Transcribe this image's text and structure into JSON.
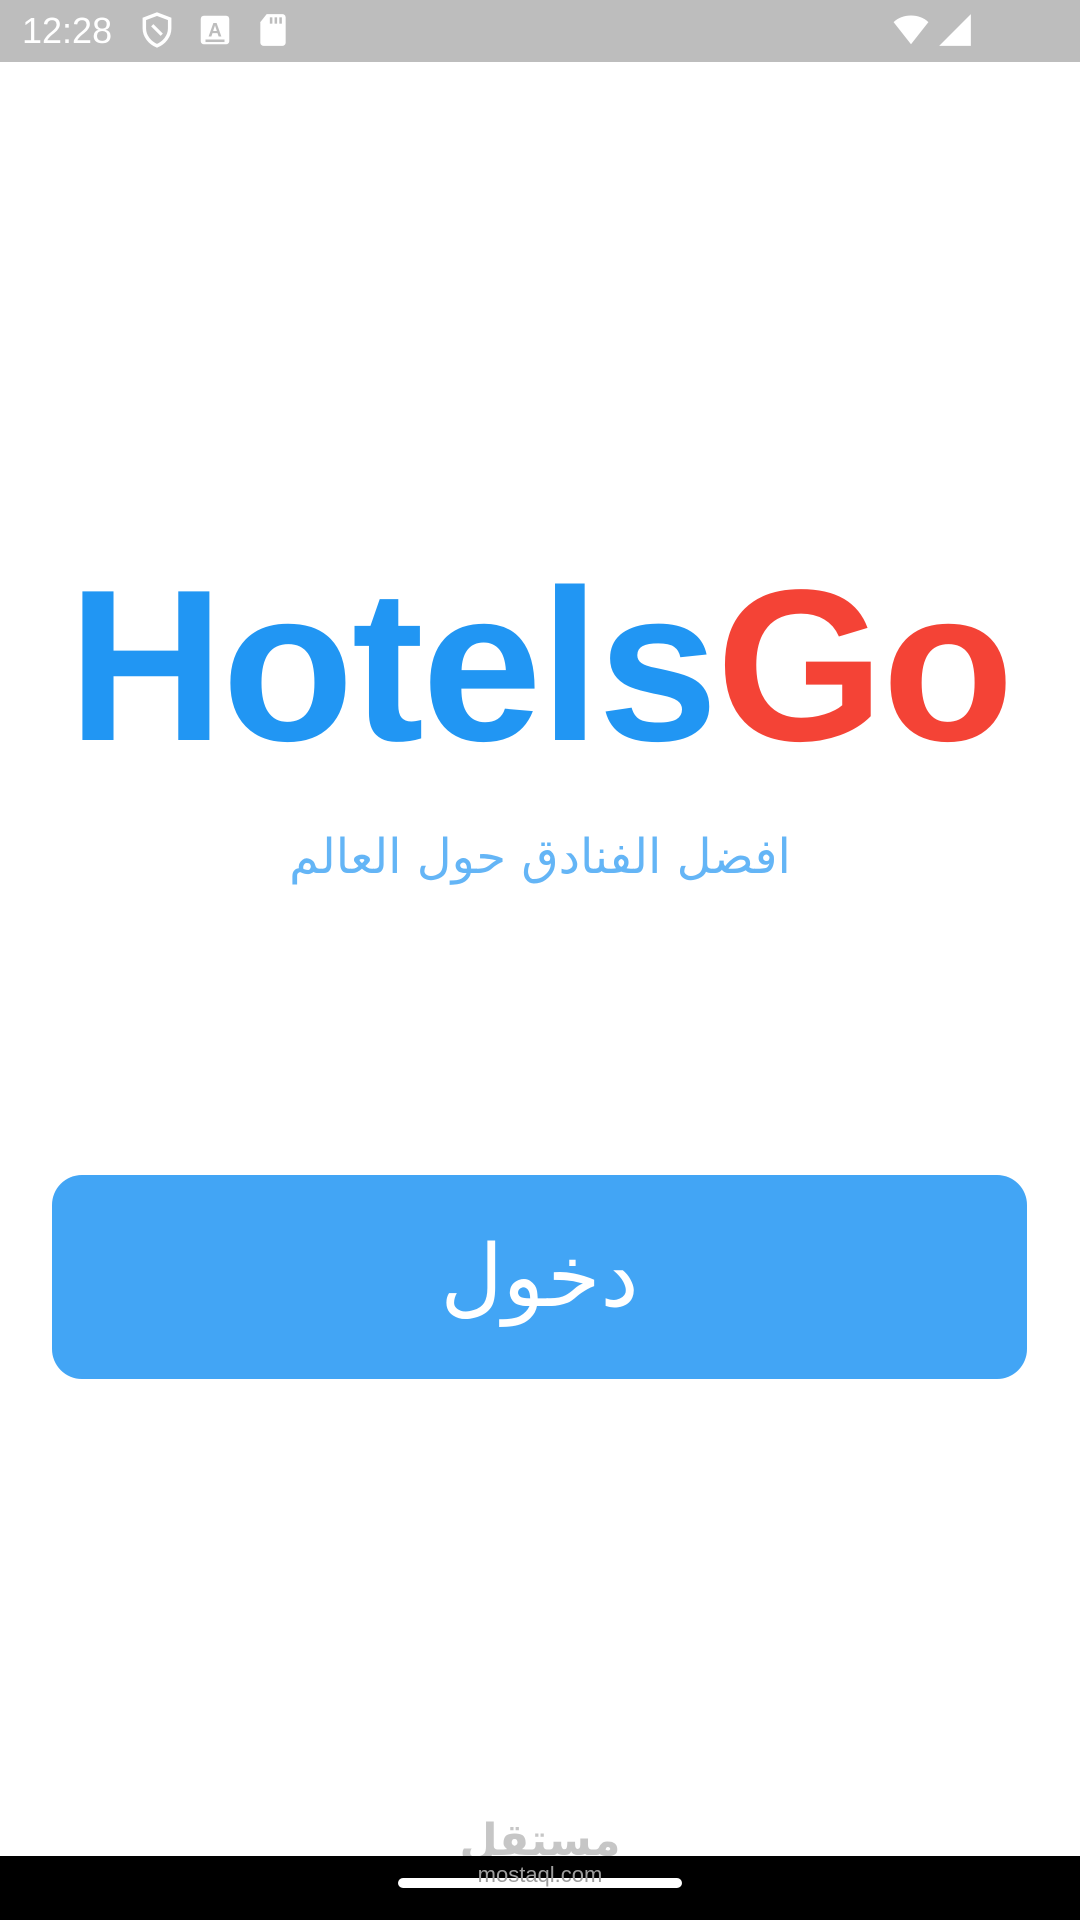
{
  "status_bar": {
    "time": "12:28",
    "icons_left": [
      "shield-icon",
      "text-a-icon",
      "sd-card-icon"
    ],
    "icons_right": [
      "wifi-icon",
      "cellular-signal-icon"
    ]
  },
  "logo": {
    "part1": "Hotels",
    "part2": "Go",
    "colors": {
      "part1": "#2196f3",
      "part2": "#f44336"
    }
  },
  "tagline": "افضل الفنادق حول العالم",
  "login_button": {
    "label": "دخول",
    "color": "#42a5f5"
  },
  "watermark": {
    "logo_text": "مستقل",
    "url": "mostaql.com"
  }
}
